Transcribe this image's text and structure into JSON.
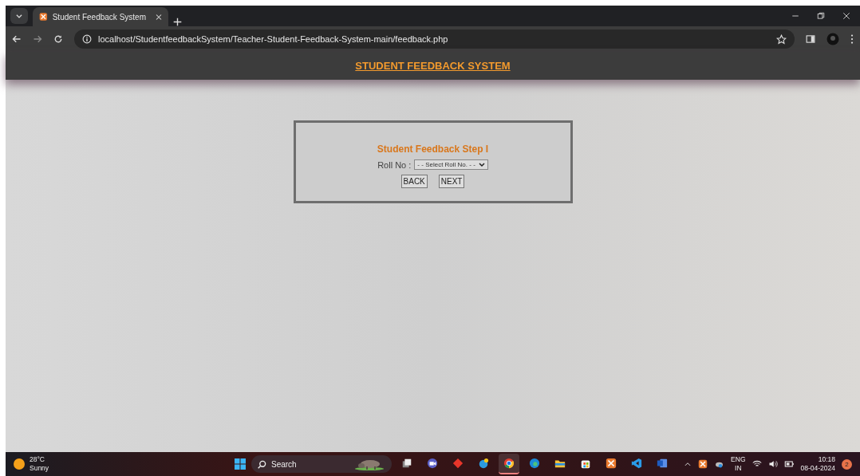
{
  "browser": {
    "tab": {
      "title": "Student Feedback System",
      "selected": true
    },
    "url": "localhost/StudentfeedbackSystem/Teacher-Student-Feedback-System-main/feedback.php"
  },
  "page": {
    "header": "STUDENT FEEDBACK SYSTEM",
    "form": {
      "title": "Student Feedback Step I",
      "label": "Roll No :",
      "select": "- - Select Roll No. - -",
      "buttons": [
        "BACK",
        "NEXT"
      ]
    }
  },
  "taskbar": {
    "weather": {
      "temp": "28°C",
      "condition": "Sunny"
    },
    "search": {
      "placeholder": "Search"
    },
    "apps": [
      {
        "kind": "taskview",
        "selected": false
      },
      {
        "kind": "meet",
        "selected": false
      },
      {
        "kind": "diamond",
        "selected": false
      },
      {
        "kind": "help",
        "selected": false
      },
      {
        "kind": "chrome",
        "selected": true
      },
      {
        "kind": "edge",
        "selected": false
      },
      {
        "kind": "files",
        "selected": false
      },
      {
        "kind": "store",
        "selected": false
      },
      {
        "kind": "xampp",
        "selected": false
      },
      {
        "kind": "vscode",
        "selected": false
      },
      {
        "kind": "word",
        "selected": false
      }
    ],
    "language": [
      "ENG",
      "IN"
    ],
    "time": "10:18",
    "date": "08-04-2024",
    "notifications": "2"
  }
}
